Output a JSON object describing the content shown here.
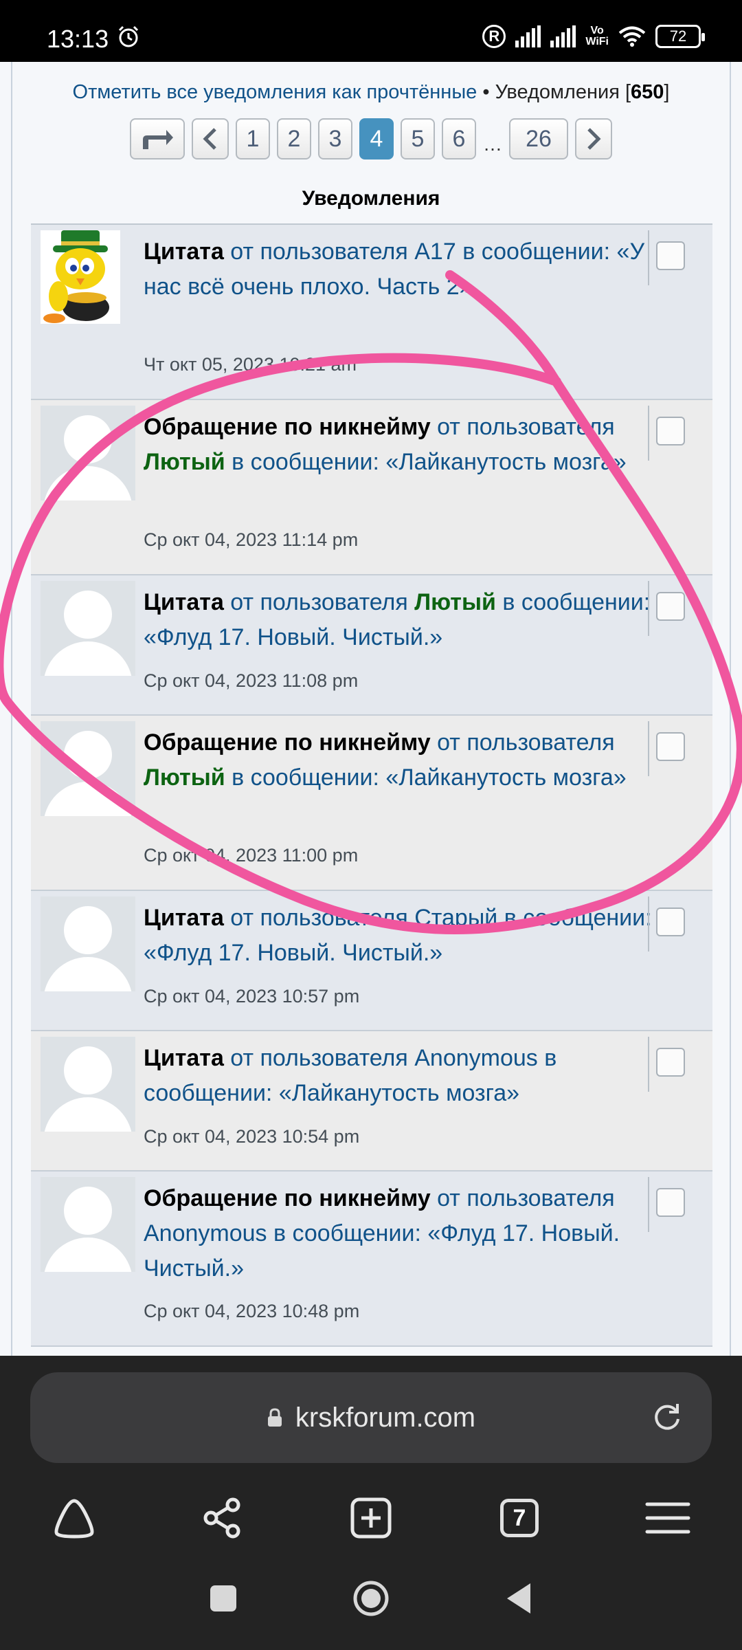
{
  "status_bar": {
    "time": "13:13",
    "alarm_icon": "alarm-clock-icon",
    "r_badge": "R",
    "vowifi_top": "Vo",
    "vowifi_bottom": "WiFi",
    "battery": "72"
  },
  "header": {
    "mark_all_read": "Отметить все уведомления как прочтённые",
    "separator": " • ",
    "notifications_label": "Уведомления [",
    "notifications_count": "650",
    "notifications_close": "]"
  },
  "pagination": {
    "pages": [
      "1",
      "2",
      "3",
      "4",
      "5",
      "6"
    ],
    "active": "4",
    "ellipsis": "…",
    "last": "26"
  },
  "section_title": "Уведомления",
  "notifications": [
    {
      "type": "Цитата",
      "pre": " от пользователя ",
      "user": "A17",
      "user_highlight": false,
      "post": " в сообщении: «У нас всё очень плохо. Часть 2»",
      "date": "Чт окт 05, 2023 10:21 am",
      "avatar": "tweety"
    },
    {
      "type": "Обращение по никнейму",
      "pre": " от пользователя ",
      "user": "Лютый",
      "user_highlight": true,
      "post": " в сообщении: «Лайканутость мозга»",
      "date": "Ср окт 04, 2023 11:14 pm",
      "avatar": "default"
    },
    {
      "type": "Цитата",
      "pre": " от пользователя ",
      "user": "Лютый",
      "user_highlight": true,
      "post": " в сообщении: «Флуд 17. Новый. Чистый.»",
      "date": "Ср окт 04, 2023 11:08 pm",
      "avatar": "default"
    },
    {
      "type": "Обращение по никнейму",
      "pre": " от пользователя ",
      "user": "Лютый",
      "user_highlight": true,
      "post": " в сообщении: «Лайканутость мозга»",
      "date": "Ср окт 04, 2023 11:00 pm",
      "avatar": "default"
    },
    {
      "type": "Цитата",
      "pre": " от пользователя ",
      "user": "Старый",
      "user_highlight": false,
      "post": " в сообщении: «Флуд 17. Новый. Чистый.»",
      "date": "Ср окт 04, 2023 10:57 pm",
      "avatar": "default"
    },
    {
      "type": "Цитата",
      "pre": " от пользователя ",
      "user": "Anonymous",
      "user_highlight": false,
      "post": " в сообщении: «Лайканутость мозга»",
      "date": "Ср окт 04, 2023 10:54 pm",
      "avatar": "default"
    },
    {
      "type": "Обращение по никнейму",
      "pre": " от пользователя ",
      "user": "Anonymous",
      "user_highlight": false,
      "post": " в сообщении: «Флуд 17. Новый. Чистый.»",
      "date": "Ср окт 04, 2023 10:48 pm",
      "avatar": "default"
    }
  ],
  "browser": {
    "url": "krskforum.com",
    "tab_count": "7",
    "icons": [
      "home-icon",
      "share-icon",
      "new-tab-icon",
      "tabs-icon",
      "menu-icon"
    ]
  },
  "colors": {
    "link": "#105289",
    "user_green": "#0d6312",
    "active_page": "#4692bf",
    "annotation": "#f0569e"
  }
}
